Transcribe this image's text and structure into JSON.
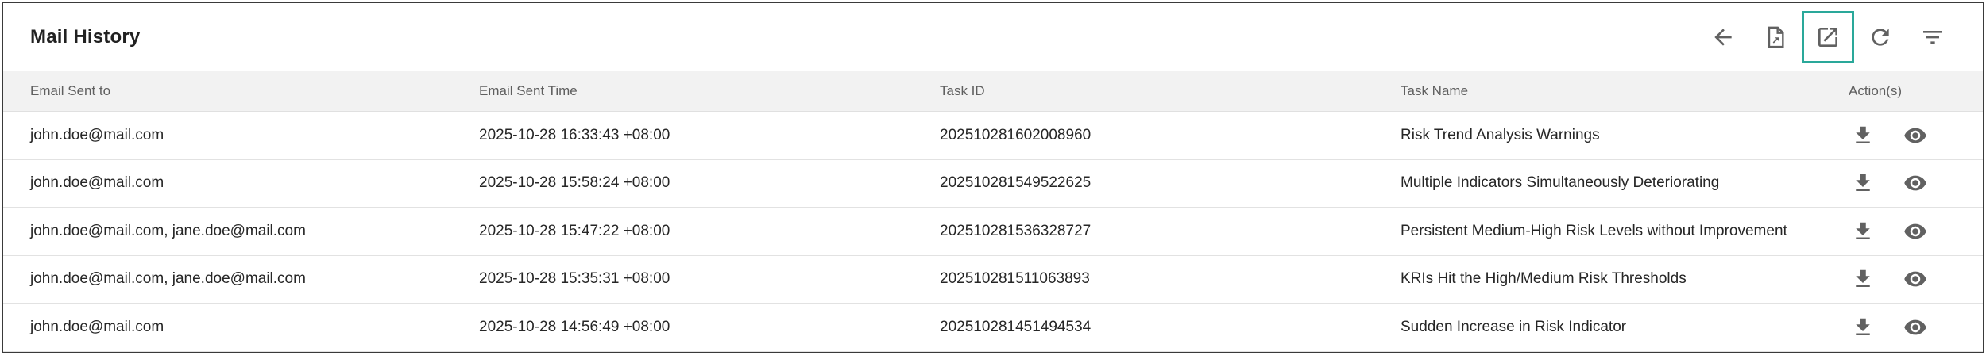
{
  "header": {
    "title": "Mail History"
  },
  "toolbar": {
    "buttons": [
      {
        "icon": "arrow-back-icon",
        "name": "back-button"
      },
      {
        "icon": "export-document-icon",
        "name": "export-document-button"
      },
      {
        "icon": "open-in-new-icon",
        "name": "open-in-new-button",
        "active": true
      },
      {
        "icon": "refresh-icon",
        "name": "refresh-button"
      },
      {
        "icon": "filter-icon",
        "name": "filter-button"
      }
    ],
    "active_color": "#2aa89a"
  },
  "table": {
    "columns": [
      "Email Sent to",
      "Email Sent Time",
      "Task ID",
      "Task Name",
      "Action(s)"
    ],
    "rows": [
      {
        "to": "john.doe@mail.com",
        "time": "2025-10-28 16:33:43 +08:00",
        "task_id": "202510281602008960",
        "task_name": "Risk Trend Analysis Warnings"
      },
      {
        "to": "john.doe@mail.com",
        "time": "2025-10-28 15:58:24 +08:00",
        "task_id": "202510281549522625",
        "task_name": "Multiple Indicators Simultaneously Deteriorating"
      },
      {
        "to": "john.doe@mail.com, jane.doe@mail.com",
        "time": "2025-10-28 15:47:22 +08:00",
        "task_id": "202510281536328727",
        "task_name": "Persistent Medium-High Risk Levels without Improvement"
      },
      {
        "to": "john.doe@mail.com, jane.doe@mail.com",
        "time": "2025-10-28 15:35:31 +08:00",
        "task_id": "202510281511063893",
        "task_name": "KRIs Hit the High/Medium Risk Thresholds"
      },
      {
        "to": "john.doe@mail.com",
        "time": "2025-10-28 14:56:49 +08:00",
        "task_id": "202510281451494534",
        "task_name": "Sudden Increase in Risk Indicator"
      }
    ],
    "row_actions": [
      "download-icon",
      "view-icon"
    ]
  }
}
